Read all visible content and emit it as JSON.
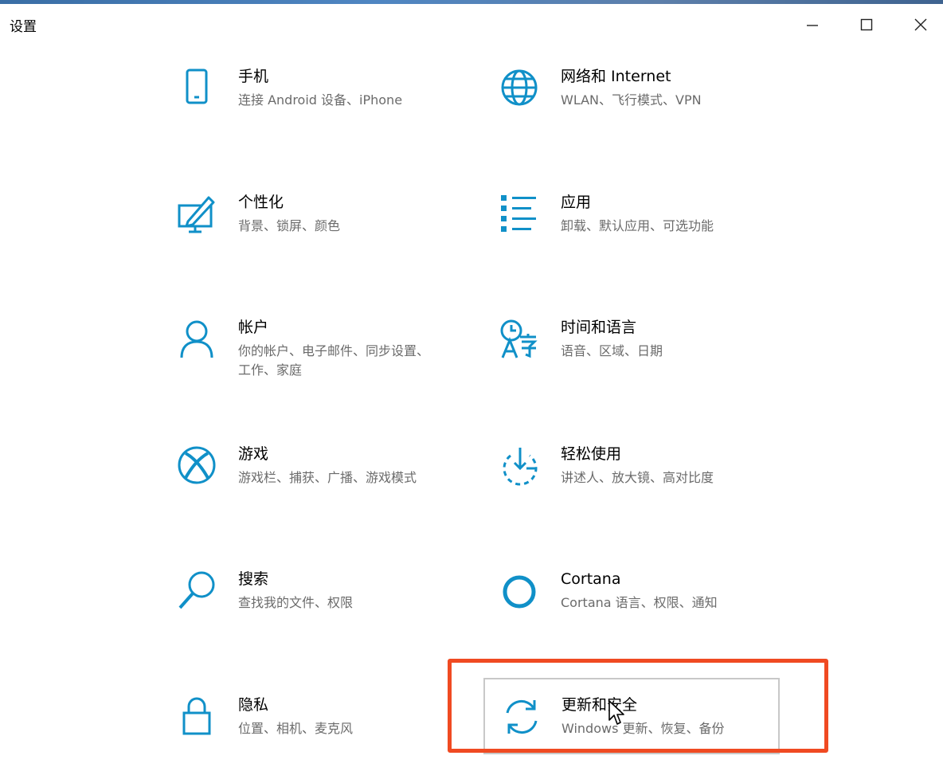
{
  "window": {
    "title": "设置"
  },
  "tiles": [
    {
      "id": "phone",
      "name": "手机",
      "desc": "连接 Android 设备、iPhone",
      "icon": "phone-icon"
    },
    {
      "id": "network",
      "name": "网络和 Internet",
      "desc": "WLAN、飞行模式、VPN",
      "icon": "globe-icon"
    },
    {
      "id": "personalization",
      "name": "个性化",
      "desc": "背景、锁屏、颜色",
      "icon": "personalization-icon"
    },
    {
      "id": "apps",
      "name": "应用",
      "desc": "卸载、默认应用、可选功能",
      "icon": "apps-list-icon"
    },
    {
      "id": "accounts",
      "name": "帐户",
      "desc": "你的帐户、电子邮件、同步设置、工作、家庭",
      "icon": "person-icon"
    },
    {
      "id": "time-language",
      "name": "时间和语言",
      "desc": "语音、区域、日期",
      "icon": "time-language-icon"
    },
    {
      "id": "gaming",
      "name": "游戏",
      "desc": "游戏栏、捕获、广播、游戏模式",
      "icon": "xbox-icon"
    },
    {
      "id": "ease-of-access",
      "name": "轻松使用",
      "desc": "讲述人、放大镜、高对比度",
      "icon": "ease-of-access-icon"
    },
    {
      "id": "search",
      "name": "搜索",
      "desc": "查找我的文件、权限",
      "icon": "search-icon"
    },
    {
      "id": "cortana",
      "name": "Cortana",
      "desc": "Cortana 语言、权限、通知",
      "icon": "cortana-icon"
    },
    {
      "id": "privacy",
      "name": "隐私",
      "desc": "位置、相机、麦克风",
      "icon": "lock-icon"
    },
    {
      "id": "update-security",
      "name": "更新和安全",
      "desc": "Windows 更新、恢复、备份",
      "icon": "refresh-icon"
    }
  ],
  "colors": {
    "accent": "#1090c8",
    "highlight": "#f04a22"
  }
}
